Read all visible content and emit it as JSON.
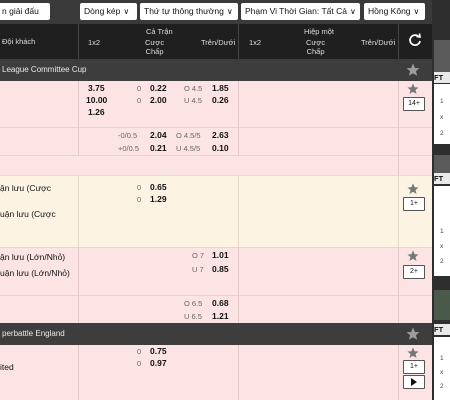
{
  "toolbar": {
    "left_button": "n giải đấu",
    "bet_type": "Dòng kép",
    "order": "Thứ tự thông thường",
    "time_range": "Phạm Vi Thời Gian: Tất Cả",
    "odds_format": "Hồng Kông"
  },
  "header": {
    "team_col": "Đội khách",
    "full_time": "Cả Trận",
    "half": "Hiệp một",
    "col_1x2": "1x2",
    "col_handicap": "Cược\nChấp",
    "col_overunder": "Trên/Dưới",
    "col_1x2_h": "1x2",
    "col_handicap_h": "Cược\nChấp",
    "col_overunder_h": "Trên/Dưới"
  },
  "leagues": [
    {
      "name": "League Committee Cup"
    },
    {
      "name": "perbattle England"
    }
  ],
  "rows": {
    "r1": {
      "x1": "3.75",
      "x2": "10.00",
      "x3": "1.26",
      "h1": "0",
      "h1v": "0.22",
      "h2": "0",
      "h2v": "2.00",
      "o1": "O 4.5",
      "o1v": "1.85",
      "o2": "U 4.5",
      "o2v": "0.26",
      "more": "14+"
    },
    "r2": {
      "h1": "-0/0.5",
      "h1v": "2.04",
      "h2": "+0/0.5",
      "h2v": "0.21",
      "o1": "O 4.5/5",
      "o1v": "2.63",
      "o2": "U 4.5/5",
      "o2v": "0.10"
    },
    "r3": {
      "team1": "ận lưu (Cược",
      "team2": "uận lưu (Cược",
      "h1": "0",
      "h1v": "0.65",
      "h2": "0",
      "h2v": "1.29",
      "more": "1+"
    },
    "r4": {
      "team1": "ận lưu (Lớn/Nhỏ)",
      "team2": "uận lưu (Lớn/Nhỏ)",
      "o1": "O 7",
      "o1v": "1.01",
      "o2": "U 7",
      "o2v": "0.85",
      "more": "2+"
    },
    "r5": {
      "o1": "O 6.5",
      "o1v": "0.68",
      "o2": "U 6.5",
      "o2v": "1.21"
    },
    "r6": {
      "team2": "ited",
      "h1": "0",
      "h1v": "0.75",
      "h2": "0",
      "h2v": "0.97",
      "more": "1+"
    }
  },
  "right_panel": {
    "ft1": "FT",
    "ft2": "FT",
    "ft3": "FT",
    "n1": "1",
    "n2": "x",
    "n3": "2",
    "n4": "1",
    "n5": "x",
    "n6": "2",
    "n7": "1",
    "n8": "x",
    "n9": "2"
  },
  "colors": {
    "header_bg": "#1f1f1f",
    "row_pink": "#fce4e4",
    "row_cream": "#fdf3e3",
    "league_bg": "#3d3d3d"
  }
}
